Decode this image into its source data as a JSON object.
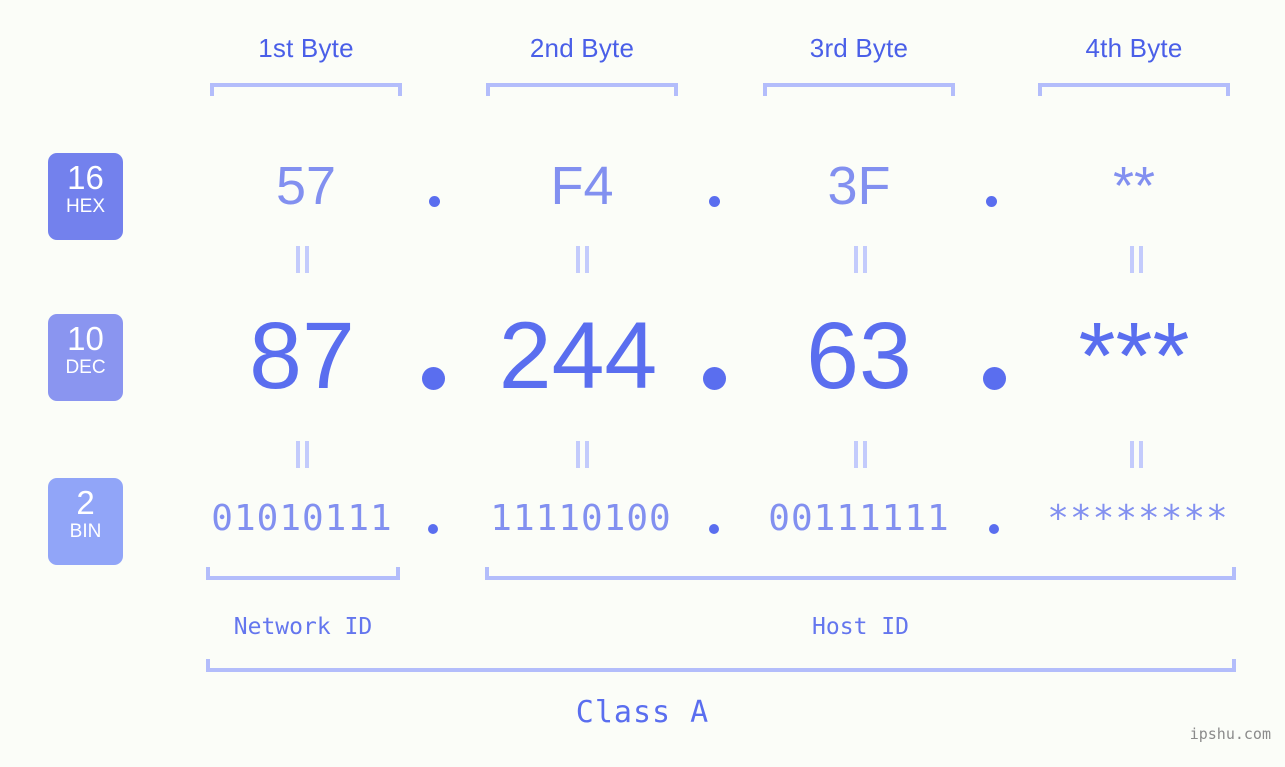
{
  "page": {
    "background_color": "#fbfdf8",
    "accent_strong": "#5a6eef",
    "accent_mid": "#8290f0",
    "accent_light": "#b3bdfb"
  },
  "byte_headers": [
    {
      "label": "1st Byte"
    },
    {
      "label": "2nd Byte"
    },
    {
      "label": "3rd Byte"
    },
    {
      "label": "4th Byte"
    }
  ],
  "rows": [
    {
      "badge_base": "16",
      "badge_name": "HEX",
      "badge_color": "#7381ed",
      "values": [
        "57",
        "F4",
        "3F",
        "**"
      ],
      "separator": "."
    },
    {
      "badge_base": "10",
      "badge_name": "DEC",
      "badge_color": "#8a95f0",
      "values": [
        "87",
        "244",
        "63",
        "***"
      ],
      "separator": "."
    },
    {
      "badge_base": "2",
      "badge_name": "BIN",
      "badge_color": "#91a5f8",
      "values": [
        "01010111",
        "11110100",
        "00111111",
        "********"
      ],
      "separator": "."
    }
  ],
  "equality_marker": "||",
  "id_sections": [
    {
      "label": "Network ID"
    },
    {
      "label": "Host ID"
    }
  ],
  "class_label": "Class A",
  "watermark": "ipshu.com"
}
